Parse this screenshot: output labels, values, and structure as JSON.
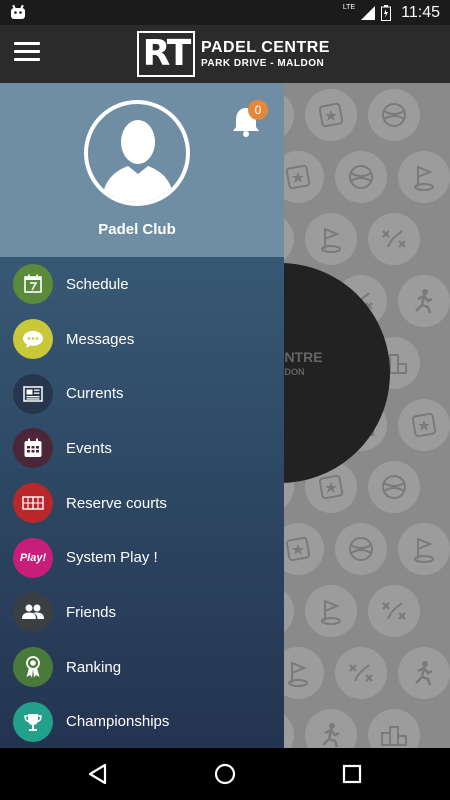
{
  "status_bar": {
    "network": "LTE",
    "time": "11:45"
  },
  "app_bar": {
    "logo_mark": "RT",
    "title": "PADEL CENTRE",
    "subtitle": "PARK DRIVE - MALDON"
  },
  "background": {
    "disc_title": "CENTRE",
    "disc_subtitle": "MALDON"
  },
  "drawer": {
    "profile_name": "Padel Club",
    "notification_count": "0",
    "items": [
      {
        "label": "Schedule",
        "icon": "calendar-day-icon",
        "color": "#5a8a3a"
      },
      {
        "label": "Messages",
        "icon": "chat-bubble-icon",
        "color": "#c8c83a"
      },
      {
        "label": "Currents",
        "icon": "newspaper-icon",
        "color": "#26364d"
      },
      {
        "label": "Events",
        "icon": "calendar-grid-icon",
        "color": "#4a2638"
      },
      {
        "label": "Reserve courts",
        "icon": "court-icon",
        "color": "#b8282a"
      },
      {
        "label": "System Play !",
        "icon_text": "Play!",
        "icon": "play-logo-icon",
        "color": "#c81e7a"
      },
      {
        "label": "Friends",
        "icon": "friends-icon",
        "color": "#3a3f44"
      },
      {
        "label": "Ranking",
        "icon": "medal-icon",
        "color": "#4a7a3a"
      },
      {
        "label": "Championships",
        "icon": "trophy-icon",
        "color": "#22a08a"
      }
    ]
  }
}
